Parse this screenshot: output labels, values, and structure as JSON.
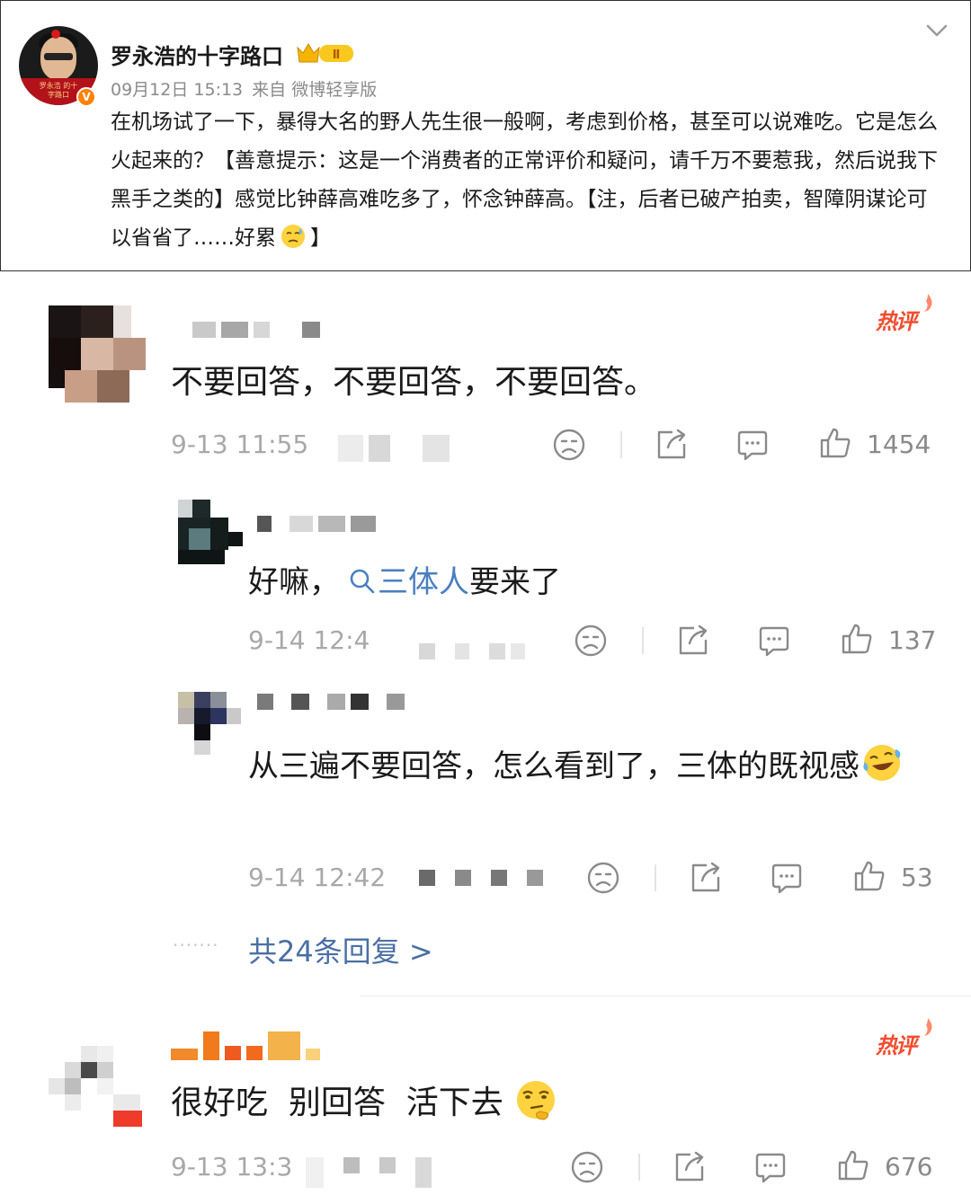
{
  "post": {
    "author": "罗永浩的十字路口",
    "avatar_caption": "罗永浩 的十字路口",
    "level_badge": "Ⅱ",
    "verified_mark": "V",
    "date": "09月12日 15:13",
    "source": "来自 微博轻享版",
    "body": "在机场试了一下，暴得大名的野人先生很一般啊，考虑到价格，甚至可以说难吃。它是怎么火起来的？【善意提示：这是一个消费者的正常评价和疑问，请千万不要惹我，然后说我下黑手之类的】感觉比钟薛高难吃多了，怀念钟薛高。【注，后者已破产拍卖，智障阴谋论可以省省了……好累",
    "body_end": "】",
    "emoji": "sweat-emoji"
  },
  "comments": [
    {
      "hot_label": "热评",
      "text": "不要回答，不要回答，不要回答。",
      "time": "9-13 11:55",
      "likes": "1454",
      "replies": [
        {
          "text_before": "好嘛，",
          "link_text": "三体人",
          "text_after": "要来了",
          "time": "9-14 12:4",
          "likes": "137"
        },
        {
          "text": "从三遍不要回答，怎么看到了，三体的既视感",
          "emoji": "laugh-cry-emoji",
          "time": "9-14 12:42",
          "likes": "53"
        }
      ],
      "more_replies": "共24条回复 >"
    },
    {
      "hot_label": "热评",
      "text": "很好吃  别回答  活下去",
      "emoji": "smirk-emoji",
      "time": "9-13 13:3",
      "likes": "676"
    }
  ],
  "colors": {
    "hot_label": "#f24c2e",
    "link": "#4a7fc1",
    "more_replies": "#4a6fa5",
    "verified": "#ff8200"
  }
}
